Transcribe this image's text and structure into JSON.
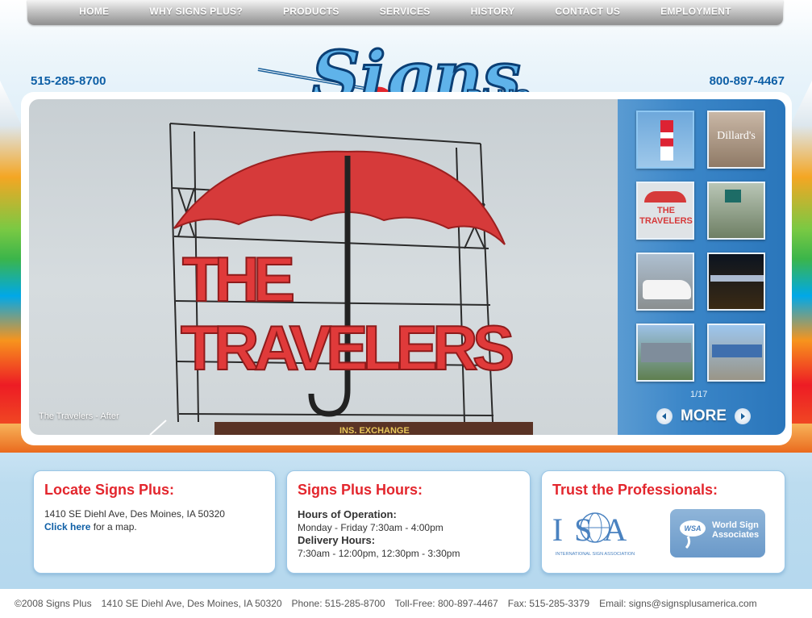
{
  "nav": {
    "items": [
      "HOME",
      "WHY SIGNS PLUS?",
      "PRODUCTS",
      "SERVICES",
      "HISTORY",
      "CONTACT US",
      "EMPLOYMENT"
    ]
  },
  "header": {
    "phone_local": "515-285-8700",
    "phone_tollfree": "800-897-4467",
    "logo_text_main": "Signs",
    "logo_text_sub": "PLUS"
  },
  "slideshow": {
    "caption": "The Travelers - After",
    "sign_line1": "THE",
    "sign_line2": "TRAVELERS",
    "building_text": "INS. EXCHANGE",
    "counter": "1/17",
    "more_label": "MORE",
    "thumbnails": [
      {
        "text": "",
        "icon": "tower-sign-thumbnail"
      },
      {
        "text": "Dillard's",
        "icon": "storefront-thumbnail"
      },
      {
        "text": "THE TRAVELERS",
        "icon": "umbrella-sign-thumbnail"
      },
      {
        "text": "",
        "icon": "building-sign-thumbnail"
      },
      {
        "text": "",
        "icon": "van-thumbnail"
      },
      {
        "text": "",
        "icon": "night-sign-thumbnail"
      },
      {
        "text": "",
        "icon": "stadium-thumbnail"
      },
      {
        "text": "",
        "icon": "store-thumbnail"
      }
    ]
  },
  "locate": {
    "title": "Locate Signs Plus:",
    "address": "1410 SE Diehl Ave, Des Moines, IA 50320",
    "link": "Click here",
    "link_suffix": " for a map."
  },
  "hours": {
    "title": "Signs Plus Hours:",
    "op_label": "Hours of Operation:",
    "op_value": "Monday - Friday 7:30am - 4:00pm",
    "del_label": "Delivery Hours:",
    "del_value": "7:30am - 12:00pm, 12:30pm - 3:30pm"
  },
  "trust": {
    "title": "Trust the Professionals:",
    "isa_letters": "ISA",
    "isa_caption": "INTERNATIONAL SIGN ASSOCIATION",
    "wsa_badge": "WSA",
    "wsa_text": "World Sign Associates"
  },
  "footer": {
    "copyright": "©2008 Signs Plus",
    "address": "1410 SE Diehl Ave, Des Moines, IA 50320",
    "phone": "Phone: 515-285-8700",
    "tollfree": "Toll-Free: 800-897-4467",
    "fax": "Fax: 515-285-3379",
    "email": "Email: signs@signsplusamerica.com"
  },
  "colors": {
    "accent_blue": "#0e5fa6",
    "title_red": "#e3262d",
    "panel_blue": "#2a76bb"
  }
}
